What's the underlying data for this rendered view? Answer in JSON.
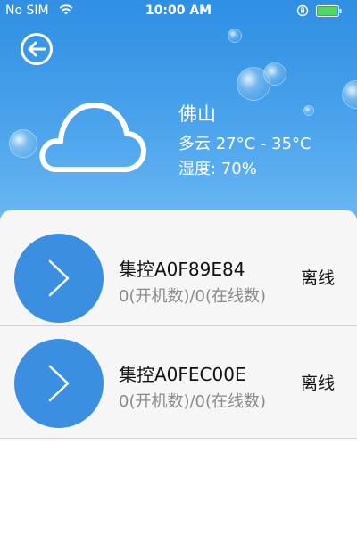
{
  "status_bar": {
    "carrier": "No SIM",
    "time": "10:00 AM",
    "icons": [
      "wifi-icon",
      "rotation-lock-icon",
      "battery-icon"
    ]
  },
  "header": {
    "back_icon": "back-arrow-circle-icon",
    "weather_icon": "cloud-icon",
    "city": "佛山",
    "weather": "多云 27°C - 35°C",
    "humidity": "湿度: 70%"
  },
  "devices": [
    {
      "name": "集控A0F89E84",
      "counts": "0(开机数)/0(在线数)",
      "status": "离线",
      "icon": "chevron-right-icon"
    },
    {
      "name": "集控A0FEC00E",
      "counts": "0(开机数)/0(在线数)",
      "status": "离线",
      "icon": "chevron-right-icon"
    }
  ],
  "colors": {
    "header_top": "#2f8fe3",
    "header_bottom": "#6bb8f2",
    "circle": "#3a8fe0",
    "row_bg": "#f6f6f6",
    "muted_text": "#8a8a8a"
  }
}
